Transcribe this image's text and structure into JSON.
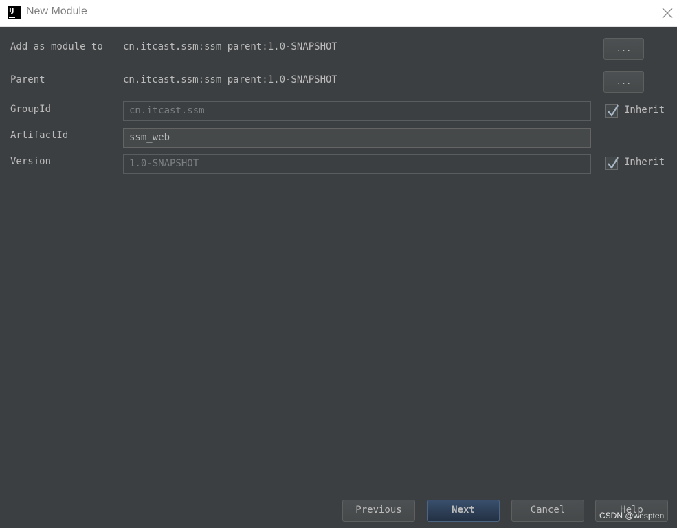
{
  "window": {
    "title": "New Module",
    "logo_text": "IJ"
  },
  "form": {
    "add_as_module": {
      "label": "Add as module to",
      "value": "cn.itcast.ssm:ssm_parent:1.0-SNAPSHOT",
      "button": "..."
    },
    "parent": {
      "label": "Parent",
      "value": "cn.itcast.ssm:ssm_parent:1.0-SNAPSHOT",
      "button": "..."
    },
    "group_id": {
      "label": "GroupId",
      "value": "cn.itcast.ssm",
      "inherit_label": "Inherit",
      "inherit_checked": true
    },
    "artifact_id": {
      "label": "ArtifactId",
      "value": "ssm_web"
    },
    "version": {
      "label": "Version",
      "value": "1.0-SNAPSHOT",
      "inherit_label": "Inherit",
      "inherit_checked": true
    }
  },
  "footer": {
    "previous": "Previous",
    "next": "Next",
    "cancel": "Cancel",
    "help": "Help"
  },
  "watermark": "CSDN @wespten",
  "icons": {
    "logo": "intellij-logo-icon",
    "close": "close-icon",
    "check": "check-icon"
  },
  "colors": {
    "background": "#3c3f41",
    "text": "#bbbbbb",
    "primary_button": "#2c3e55"
  }
}
